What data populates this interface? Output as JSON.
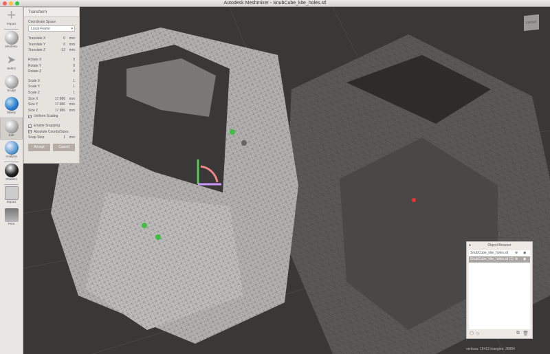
{
  "window": {
    "title": "Autodesk Meshmixer - SnubCube_kite_holes.stl"
  },
  "toolbar": {
    "items": [
      {
        "label": "Import",
        "icon": "plus-icon"
      },
      {
        "label": "Meshmix",
        "icon": "meshmix-icon"
      },
      {
        "label": "Select",
        "icon": "cursor-arrow-icon"
      },
      {
        "label": "Sculpt",
        "icon": "brush-sphere-icon"
      },
      {
        "label": "Stamp",
        "icon": "stamp-icon"
      },
      {
        "label": "Edit",
        "icon": "edit-sphere-icon",
        "active": true
      },
      {
        "label": "Analysis",
        "icon": "analysis-sphere-icon"
      },
      {
        "label": "Shaders",
        "icon": "shader-sphere-icon"
      },
      {
        "label": "Export",
        "icon": "export-icon"
      },
      {
        "label": "Print",
        "icon": "printer-icon"
      }
    ]
  },
  "transform": {
    "title": "Transform",
    "coord_label": "Coordinate Space",
    "coord_value": "Local Frame",
    "translate": [
      {
        "l": "Translate X",
        "v": "0",
        "u": "mm"
      },
      {
        "l": "Translate Y",
        "v": "0",
        "u": "mm"
      },
      {
        "l": "Translate Z",
        "v": "-13",
        "u": "mm"
      }
    ],
    "rotate": [
      {
        "l": "Rotate X",
        "v": "0"
      },
      {
        "l": "Rotate Y",
        "v": "0"
      },
      {
        "l": "Rotate Z",
        "v": "0"
      }
    ],
    "scale": [
      {
        "l": "Scale X",
        "v": "1"
      },
      {
        "l": "Scale Y",
        "v": "1"
      },
      {
        "l": "Scale Z",
        "v": "1"
      }
    ],
    "size": [
      {
        "l": "Size X",
        "v": "17.986",
        "u": "mm"
      },
      {
        "l": "Size Y",
        "v": "17.986",
        "u": "mm"
      },
      {
        "l": "Size Z",
        "v": "17.986",
        "u": "mm"
      }
    ],
    "uniform": "Uniform Scaling",
    "snapping": "Enable Snapping",
    "absolute": "Absolute Coords/Sizes",
    "snap_step": {
      "l": "Snap Step",
      "v": "1",
      "u": "mm"
    },
    "accept": "Accept",
    "cancel": "Cancel"
  },
  "viewcube": {
    "label": "FRONT"
  },
  "object_browser": {
    "title": "Object Browser",
    "items": [
      "SnubCube_kite_holes.stl",
      "SnubCube_kite_holes.stl (1)"
    ],
    "selected": 1
  },
  "status": "vertices: 18412 triangles: 36884",
  "colors": {
    "accent": "#a9a5a1",
    "viewport": "#3a3836",
    "mesh": "#a8a6a4"
  }
}
